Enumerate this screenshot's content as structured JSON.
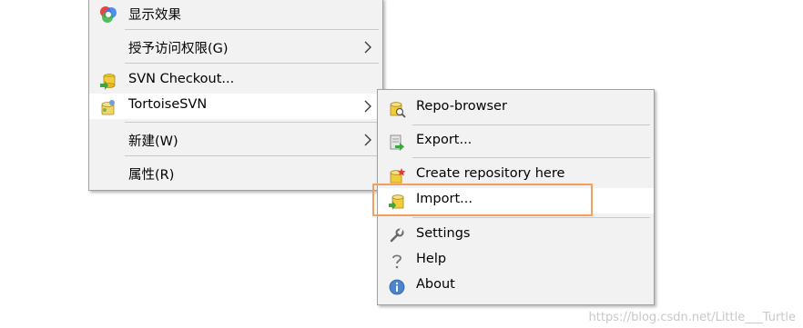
{
  "main_menu": {
    "items": [
      {
        "label": "显示效果"
      },
      {
        "label": "授予访问权限(G)"
      },
      {
        "label": "SVN Checkout..."
      },
      {
        "label": "TortoiseSVN"
      },
      {
        "label": "新建(W)"
      },
      {
        "label": "属性(R)"
      }
    ]
  },
  "submenu": {
    "items": [
      {
        "label": "Repo-browser"
      },
      {
        "label": "Export..."
      },
      {
        "label": "Create repository here"
      },
      {
        "label": "Import..."
      },
      {
        "label": "Settings"
      },
      {
        "label": "Help"
      },
      {
        "label": "About"
      }
    ]
  },
  "highlight": {
    "color": "#f5a05a"
  },
  "watermark": "https://blog.csdn.net/Little___Turtle"
}
